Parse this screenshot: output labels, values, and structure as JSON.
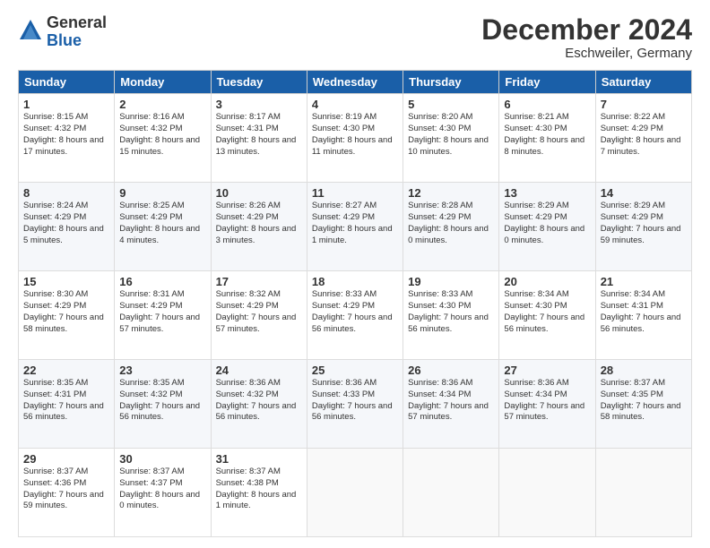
{
  "logo": {
    "general": "General",
    "blue": "Blue"
  },
  "header": {
    "month": "December 2024",
    "location": "Eschweiler, Germany"
  },
  "weekdays": [
    "Sunday",
    "Monday",
    "Tuesday",
    "Wednesday",
    "Thursday",
    "Friday",
    "Saturday"
  ],
  "weeks": [
    [
      {
        "day": "1",
        "sunrise": "8:15 AM",
        "sunset": "4:32 PM",
        "daylight": "8 hours and 17 minutes."
      },
      {
        "day": "2",
        "sunrise": "8:16 AM",
        "sunset": "4:32 PM",
        "daylight": "8 hours and 15 minutes."
      },
      {
        "day": "3",
        "sunrise": "8:17 AM",
        "sunset": "4:31 PM",
        "daylight": "8 hours and 13 minutes."
      },
      {
        "day": "4",
        "sunrise": "8:19 AM",
        "sunset": "4:30 PM",
        "daylight": "8 hours and 11 minutes."
      },
      {
        "day": "5",
        "sunrise": "8:20 AM",
        "sunset": "4:30 PM",
        "daylight": "8 hours and 10 minutes."
      },
      {
        "day": "6",
        "sunrise": "8:21 AM",
        "sunset": "4:30 PM",
        "daylight": "8 hours and 8 minutes."
      },
      {
        "day": "7",
        "sunrise": "8:22 AM",
        "sunset": "4:29 PM",
        "daylight": "8 hours and 7 minutes."
      }
    ],
    [
      {
        "day": "8",
        "sunrise": "8:24 AM",
        "sunset": "4:29 PM",
        "daylight": "8 hours and 5 minutes."
      },
      {
        "day": "9",
        "sunrise": "8:25 AM",
        "sunset": "4:29 PM",
        "daylight": "8 hours and 4 minutes."
      },
      {
        "day": "10",
        "sunrise": "8:26 AM",
        "sunset": "4:29 PM",
        "daylight": "8 hours and 3 minutes."
      },
      {
        "day": "11",
        "sunrise": "8:27 AM",
        "sunset": "4:29 PM",
        "daylight": "8 hours and 1 minute."
      },
      {
        "day": "12",
        "sunrise": "8:28 AM",
        "sunset": "4:29 PM",
        "daylight": "8 hours and 0 minutes."
      },
      {
        "day": "13",
        "sunrise": "8:29 AM",
        "sunset": "4:29 PM",
        "daylight": "8 hours and 0 minutes."
      },
      {
        "day": "14",
        "sunrise": "8:29 AM",
        "sunset": "4:29 PM",
        "daylight": "7 hours and 59 minutes."
      }
    ],
    [
      {
        "day": "15",
        "sunrise": "8:30 AM",
        "sunset": "4:29 PM",
        "daylight": "7 hours and 58 minutes."
      },
      {
        "day": "16",
        "sunrise": "8:31 AM",
        "sunset": "4:29 PM",
        "daylight": "7 hours and 57 minutes."
      },
      {
        "day": "17",
        "sunrise": "8:32 AM",
        "sunset": "4:29 PM",
        "daylight": "7 hours and 57 minutes."
      },
      {
        "day": "18",
        "sunrise": "8:33 AM",
        "sunset": "4:29 PM",
        "daylight": "7 hours and 56 minutes."
      },
      {
        "day": "19",
        "sunrise": "8:33 AM",
        "sunset": "4:30 PM",
        "daylight": "7 hours and 56 minutes."
      },
      {
        "day": "20",
        "sunrise": "8:34 AM",
        "sunset": "4:30 PM",
        "daylight": "7 hours and 56 minutes."
      },
      {
        "day": "21",
        "sunrise": "8:34 AM",
        "sunset": "4:31 PM",
        "daylight": "7 hours and 56 minutes."
      }
    ],
    [
      {
        "day": "22",
        "sunrise": "8:35 AM",
        "sunset": "4:31 PM",
        "daylight": "7 hours and 56 minutes."
      },
      {
        "day": "23",
        "sunrise": "8:35 AM",
        "sunset": "4:32 PM",
        "daylight": "7 hours and 56 minutes."
      },
      {
        "day": "24",
        "sunrise": "8:36 AM",
        "sunset": "4:32 PM",
        "daylight": "7 hours and 56 minutes."
      },
      {
        "day": "25",
        "sunrise": "8:36 AM",
        "sunset": "4:33 PM",
        "daylight": "7 hours and 56 minutes."
      },
      {
        "day": "26",
        "sunrise": "8:36 AM",
        "sunset": "4:34 PM",
        "daylight": "7 hours and 57 minutes."
      },
      {
        "day": "27",
        "sunrise": "8:36 AM",
        "sunset": "4:34 PM",
        "daylight": "7 hours and 57 minutes."
      },
      {
        "day": "28",
        "sunrise": "8:37 AM",
        "sunset": "4:35 PM",
        "daylight": "7 hours and 58 minutes."
      }
    ],
    [
      {
        "day": "29",
        "sunrise": "8:37 AM",
        "sunset": "4:36 PM",
        "daylight": "7 hours and 59 minutes."
      },
      {
        "day": "30",
        "sunrise": "8:37 AM",
        "sunset": "4:37 PM",
        "daylight": "8 hours and 0 minutes."
      },
      {
        "day": "31",
        "sunrise": "8:37 AM",
        "sunset": "4:38 PM",
        "daylight": "8 hours and 1 minute."
      },
      null,
      null,
      null,
      null
    ]
  ]
}
